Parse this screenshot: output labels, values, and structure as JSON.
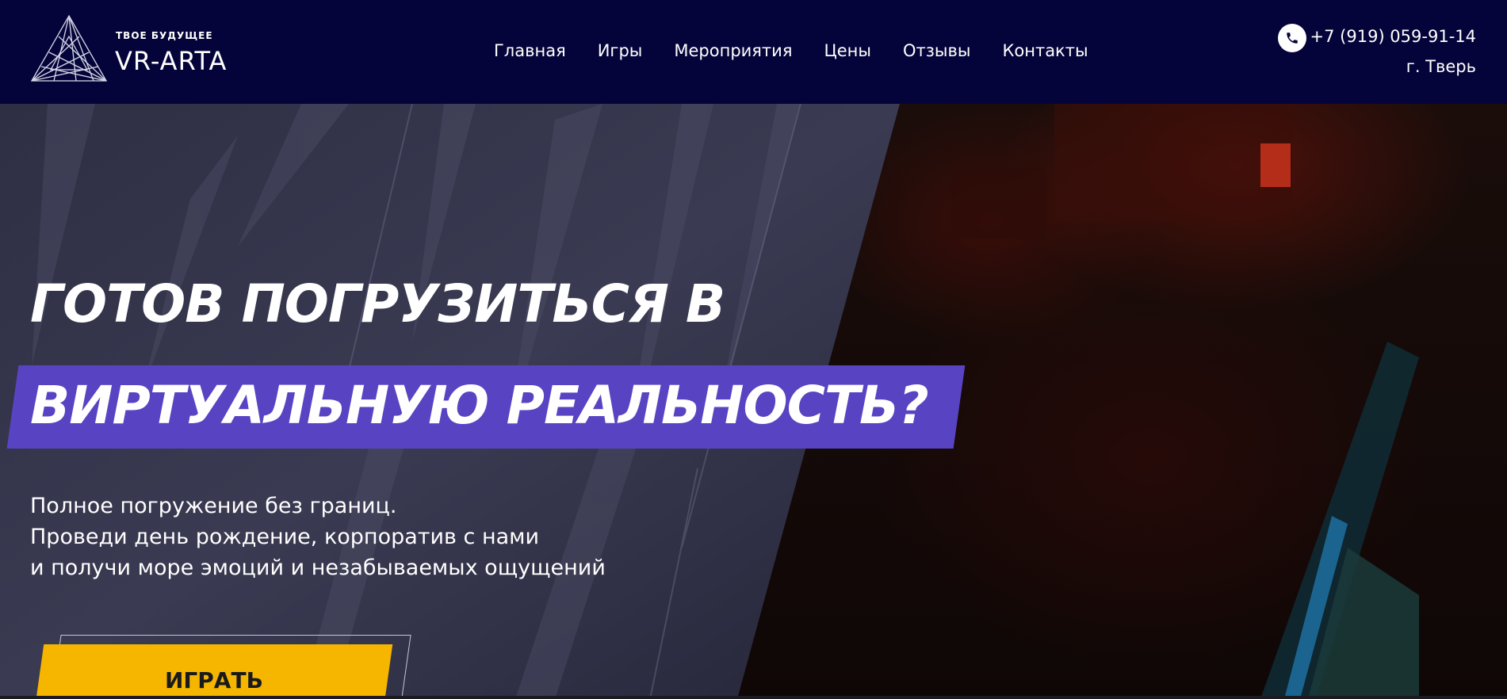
{
  "brand": {
    "tagline": "ТВОЕ БУДУЩЕЕ",
    "name": "VR-ARTA"
  },
  "nav": {
    "items": [
      "Главная",
      "Игры",
      "Мероприятия",
      "Цены",
      "Отзывы",
      "Контакты"
    ]
  },
  "contact": {
    "phone_icon": "phone-icon",
    "phone": "+7 (919) 059-91-14",
    "city": "г. Тверь"
  },
  "hero": {
    "headline_line1": "ГОТОВ ПОГРУЗИТЬСЯ В",
    "headline_line2": "ВИРТУАЛЬНУЮ РЕАЛЬНОСТЬ?",
    "sub_lines": [
      "Полное погружение без границ.",
      "Проведи день рождение, корпоратив с нами",
      "и получи море эмоций и незабываемых ощущений"
    ],
    "cta_label": "ИГРАТЬ"
  },
  "colors": {
    "header_bg": "#04043a",
    "highlight": "#5844c3",
    "cta": "#f6b600"
  }
}
